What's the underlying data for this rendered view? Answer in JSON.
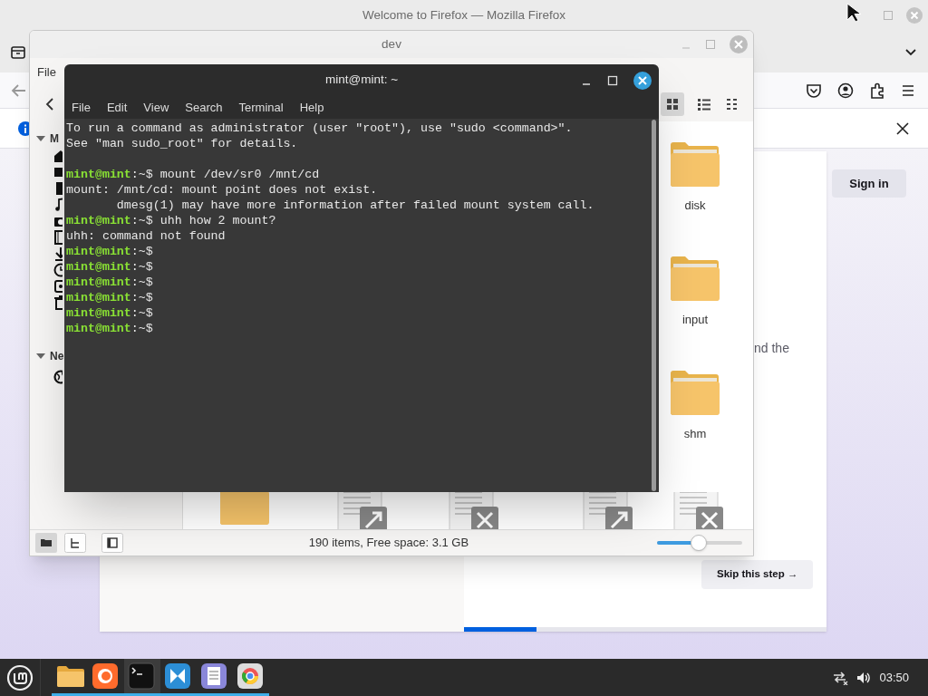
{
  "firefox": {
    "title": "Welcome to Firefox — Mozilla Firefox",
    "page": {
      "sign_in": "Sign in",
      "body_fragment": "nd the",
      "skip_button": "Skip this step →",
      "progress": {
        "level": 0.2
      }
    }
  },
  "file_manager": {
    "title": "dev",
    "menu": [
      "File"
    ],
    "sidebar_sections": [
      {
        "label": "M",
        "expanded": true
      },
      {
        "label": "Ne",
        "expanded": true
      }
    ],
    "files": [
      {
        "name": "disk"
      },
      {
        "name": "input"
      },
      {
        "name": "shm"
      }
    ],
    "bottom_items": [
      {
        "kind": "folder"
      },
      {
        "kind": "link"
      },
      {
        "kind": "broken"
      },
      {
        "kind": "link"
      },
      {
        "kind": "broken"
      }
    ],
    "status": "190 items, Free space: 3.1 GB",
    "zoom": {
      "level": 0.49
    }
  },
  "terminal": {
    "title": "mint@mint: ~",
    "menu": [
      "File",
      "Edit",
      "View",
      "Search",
      "Terminal",
      "Help"
    ],
    "lines": [
      {
        "kind": "output",
        "text": "To run a command as administrator (user \"root\"), use \"sudo <command>\"."
      },
      {
        "kind": "output",
        "text": "See \"man sudo_root\" for details."
      },
      {
        "kind": "blank"
      },
      {
        "kind": "prompt",
        "user": "mint@mint",
        "path": ":~$",
        "command": " mount /dev/sr0 /mnt/cd"
      },
      {
        "kind": "output",
        "text": "mount: /mnt/cd: mount point does not exist."
      },
      {
        "kind": "output",
        "text": "       dmesg(1) may have more information after failed mount system call."
      },
      {
        "kind": "prompt",
        "user": "mint@mint",
        "path": ":~$",
        "command": " uhh how 2 mount?"
      },
      {
        "kind": "output",
        "text": "uhh: command not found"
      },
      {
        "kind": "prompt",
        "user": "mint@mint",
        "path": ":~$"
      },
      {
        "kind": "prompt",
        "user": "mint@mint",
        "path": ":~$"
      },
      {
        "kind": "prompt",
        "user": "mint@mint",
        "path": ":~$"
      },
      {
        "kind": "prompt",
        "user": "mint@mint",
        "path": ":~$"
      },
      {
        "kind": "prompt",
        "user": "mint@mint",
        "path": ":~$"
      },
      {
        "kind": "prompt",
        "user": "mint@mint",
        "path": ":~$"
      }
    ]
  },
  "taskbar": {
    "apps": [
      {
        "kind": "files",
        "active": false
      },
      {
        "kind": "firefox",
        "active": false
      },
      {
        "kind": "terminal",
        "active": true
      },
      {
        "kind": "software",
        "active": false
      },
      {
        "kind": "editor",
        "active": false
      },
      {
        "kind": "chrome",
        "active": false
      }
    ],
    "clock": "03:50"
  }
}
